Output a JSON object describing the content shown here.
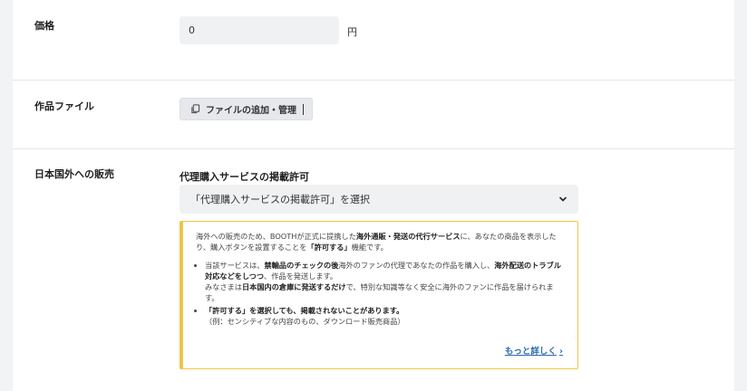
{
  "price": {
    "label": "価格",
    "value": "0",
    "unit": "円"
  },
  "file": {
    "label": "作品ファイル",
    "button_label": "ファイルの追加・管理",
    "button_icon": "file-copy-icon"
  },
  "overseas": {
    "label": "日本国外への販売",
    "permission_label": "代理購入サービスの掲載許可",
    "select_value": "「代理購入サービスの掲載許可」を選択",
    "select_icon": "chevron-down-icon",
    "notice": {
      "intro_1": "海外への販売のため、BOOTHが正式に提携した",
      "intro_bold_1": "海外通販・発送の代行サービス",
      "intro_2": "に、あなたの商品を表示したり、購入ボタンを設置することを",
      "intro_bold_2": "「許可する」",
      "intro_3": "機能です。",
      "bullet1_1": "当該サービスは、",
      "bullet1_bold_1": "禁輸品のチェックの後",
      "bullet1_2": "海外のファンの代理であなたの作品を購入し、",
      "bullet1_bold_2": "海外配送のトラブル対応などをしつつ",
      "bullet1_3": "、作品を発送します。",
      "bullet1_4": "みなさまは",
      "bullet1_bold_3": "日本国内の倉庫に発送するだけ",
      "bullet1_5": "で、特別な知識等なく安全に海外のファンに作品を届けられます。",
      "bullet2_bold": "「許可する」を選択しても、掲載されないことがあります。",
      "bullet2_note": "（例：センシティブな内容のもの、ダウンロード販売商品）",
      "more_link": "もっと詳しく",
      "more_arrow": "›"
    },
    "notice_border_color": "#f1c447",
    "link_color": "#2b6bb3"
  }
}
